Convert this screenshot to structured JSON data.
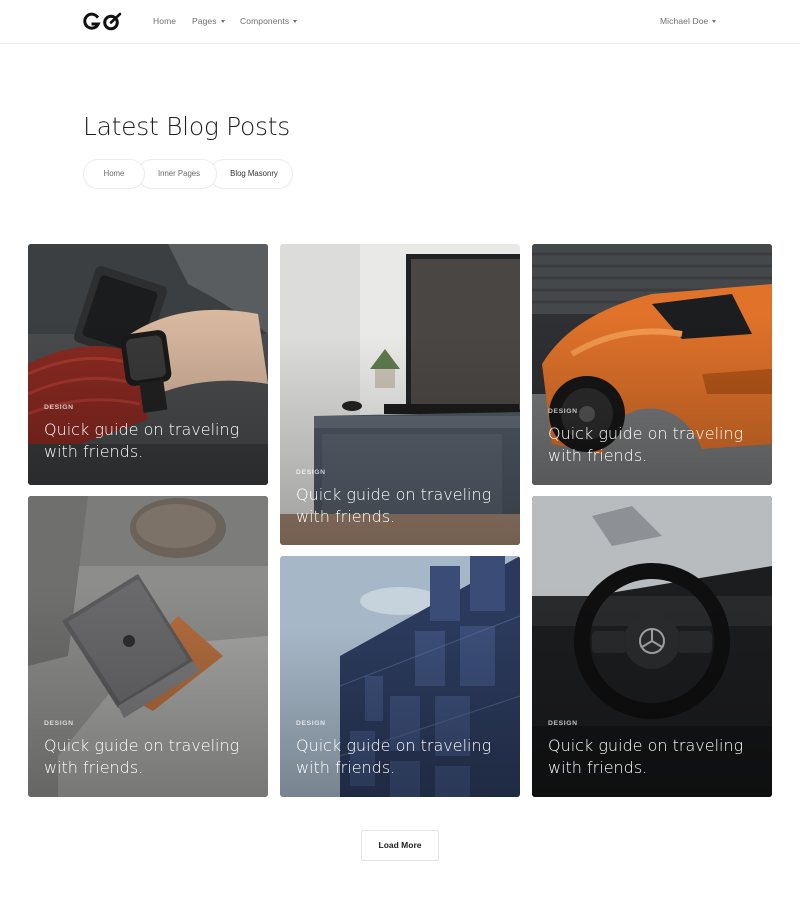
{
  "header": {
    "logo_text": "GO",
    "nav": [
      {
        "label": "Home",
        "has_dropdown": false
      },
      {
        "label": "Pages",
        "has_dropdown": true
      },
      {
        "label": "Components",
        "has_dropdown": true
      }
    ],
    "user": {
      "label": "Michael Doe",
      "has_dropdown": true
    }
  },
  "main": {
    "title": "Latest Blog Posts",
    "breadcrumb": [
      "Home",
      "Inner Pages",
      "Blog Masonry"
    ]
  },
  "posts": [
    {
      "category": "DESIGN",
      "title": "Quick guide on traveling with friends.",
      "image": "watch-wrist-photo"
    },
    {
      "category": "DESIGN",
      "title": "Quick guide on traveling with friends.",
      "image": "tv-stand-photo"
    },
    {
      "category": "DESIGN",
      "title": "Quick guide on traveling with friends.",
      "image": "orange-sports-car-photo"
    },
    {
      "category": "DESIGN",
      "title": "Quick guide on traveling with friends.",
      "image": "laptop-sofa-photo"
    },
    {
      "category": "DESIGN",
      "title": "Quick guide on traveling with friends.",
      "image": "blue-building-photo"
    },
    {
      "category": "DESIGN",
      "title": "Quick guide on traveling with friends.",
      "image": "car-steering-wheel-photo"
    }
  ],
  "load_more_label": "Load More",
  "colors": {
    "text": "#222222",
    "muted": "#6f6f6f",
    "border": "#ececec",
    "overlay_text": "#ffffff"
  }
}
